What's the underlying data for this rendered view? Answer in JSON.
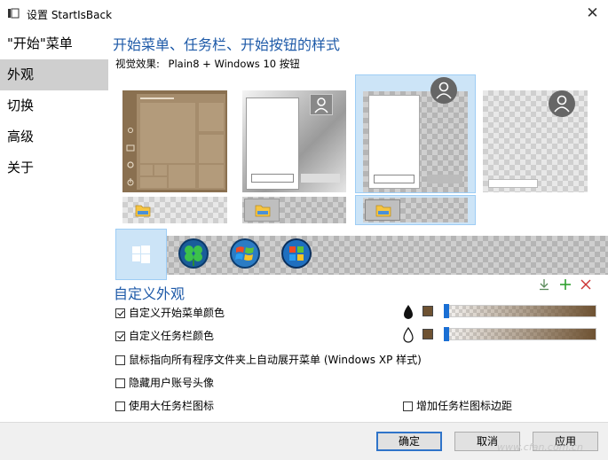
{
  "window": {
    "title": "设置 StartIsBack",
    "close_glyph": "✕"
  },
  "sidebar": {
    "items": [
      {
        "label": "\"开始\"菜单",
        "active": false
      },
      {
        "label": "外观",
        "active": true
      },
      {
        "label": "切换",
        "active": false
      },
      {
        "label": "高级",
        "active": false
      },
      {
        "label": "关于",
        "active": false
      }
    ]
  },
  "main": {
    "section_title": "开始菜单、任务栏、开始按钮的样式",
    "visual_effect_label": "视觉效果:",
    "visual_effect_value": "Plain8 + Windows 10 按钮",
    "styles": [
      {
        "name": "windows-10-style",
        "selected": false
      },
      {
        "name": "plain-light-style",
        "selected": false
      },
      {
        "name": "plain-gray-style",
        "selected": true
      },
      {
        "name": "transparent-style",
        "selected": false
      }
    ],
    "taskbar_styles": [
      {
        "name": "taskbar-1",
        "selected": false
      },
      {
        "name": "taskbar-2",
        "selected": false
      },
      {
        "name": "taskbar-3",
        "selected": true
      }
    ],
    "start_buttons": [
      {
        "icon": "windows-logo-icon",
        "selected": true
      },
      {
        "icon": "clover-orb-icon",
        "selected": false
      },
      {
        "icon": "windows7-orb-icon",
        "selected": false
      },
      {
        "icon": "windows-orb-blue-icon",
        "selected": false
      }
    ],
    "custom_title": "自定义外观",
    "custom_toolbar": [
      "download-icon",
      "add-icon",
      "remove-icon"
    ],
    "options": [
      {
        "label": "自定义开始菜单颜色",
        "checked": true
      },
      {
        "label": "自定义任务栏颜色",
        "checked": true
      },
      {
        "label": "鼠标指向所有程序文件夹上自动展开菜单 (Windows XP 样式)",
        "checked": false
      },
      {
        "label": "隐藏用户账号头像",
        "checked": false
      },
      {
        "label": "使用大任务栏图标",
        "checked": false
      },
      {
        "label": "增加任务栏图标边距",
        "checked": false
      }
    ],
    "colors": {
      "menu": "#6e5232",
      "taskbar": "#6e5232",
      "accent": "#1e5aa8"
    },
    "sliders": {
      "menu_opacity": 0.0,
      "taskbar_opacity": 0.0
    }
  },
  "footer": {
    "ok": "确定",
    "cancel": "取消",
    "apply": "应用"
  },
  "watermark": "www.cfan.com.cn"
}
